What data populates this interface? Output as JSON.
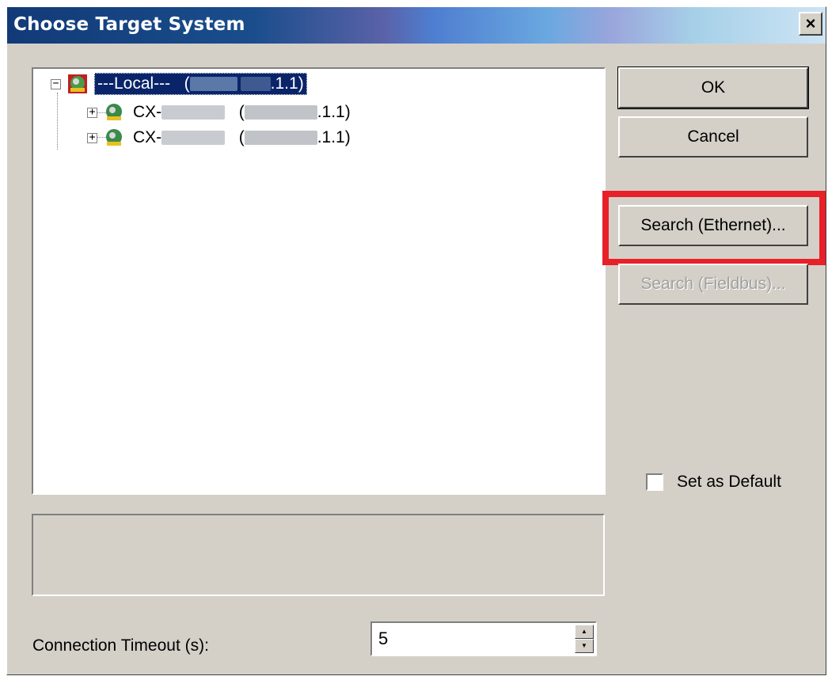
{
  "window": {
    "title": "Choose Target System",
    "close_glyph": "×"
  },
  "tree": {
    "nodes": [
      {
        "expander": "−",
        "label_prefix": "---Local---   (",
        "label_suffix": ".1.1)",
        "selected": true,
        "icon": "network-computer-icon"
      },
      {
        "expander": "+",
        "label_prefix": "CX-",
        "label_mid": "(",
        "label_suffix": ".1.1)",
        "selected": false,
        "icon": "network-computer-icon"
      },
      {
        "expander": "+",
        "label_prefix": "CX-",
        "label_mid": "(",
        "label_suffix": ".1.1)",
        "selected": false,
        "icon": "network-computer-icon"
      }
    ]
  },
  "buttons": {
    "ok": "OK",
    "cancel": "Cancel",
    "search_ethernet": "Search (Ethernet)...",
    "search_fieldbus": "Search (Fieldbus)..."
  },
  "set_default": {
    "label": "Set as Default",
    "checked": false
  },
  "timeout": {
    "label": "Connection Timeout (s):",
    "value": "5"
  },
  "colors": {
    "highlight": "#e8202a",
    "selection": "#0a246a"
  }
}
